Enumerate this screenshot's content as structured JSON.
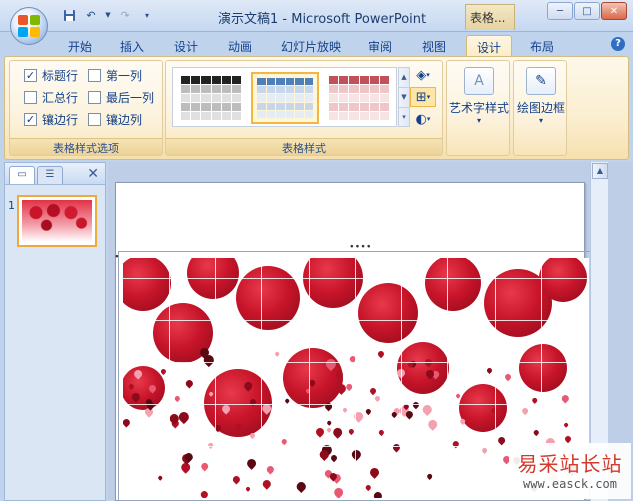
{
  "window": {
    "title": "演示文稿1 - Microsoft PowerPoint",
    "context_tab_title": "表格...",
    "minimize": "─",
    "maximize": "□",
    "close": "✕"
  },
  "tabs": [
    {
      "label": "开始"
    },
    {
      "label": "插入"
    },
    {
      "label": "设计"
    },
    {
      "label": "动画"
    },
    {
      "label": "幻灯片放映"
    },
    {
      "label": "审阅"
    },
    {
      "label": "视图"
    },
    {
      "label": "设计",
      "active": true
    },
    {
      "label": "布局"
    }
  ],
  "ribbon": {
    "style_options": {
      "label": "表格样式选项",
      "options": [
        {
          "label": "标题行",
          "checked": true
        },
        {
          "label": "第一列",
          "checked": false
        },
        {
          "label": "汇总行",
          "checked": false
        },
        {
          "label": "最后一列",
          "checked": false
        },
        {
          "label": "镶边行",
          "checked": true
        },
        {
          "label": "镶边列",
          "checked": false
        }
      ]
    },
    "table_styles": {
      "label": "表格样式"
    },
    "wordart": {
      "label": "艺术字样式"
    },
    "draw_borders": {
      "label": "绘图边框"
    }
  },
  "slide_panel": {
    "slide_number": "1"
  },
  "watermark": {
    "name": "易采站长站",
    "url": "www.easck.com"
  },
  "colors": {
    "accent": "#f2b743",
    "ribbon_text": "#15428b",
    "rose_red": "#c8152a"
  }
}
